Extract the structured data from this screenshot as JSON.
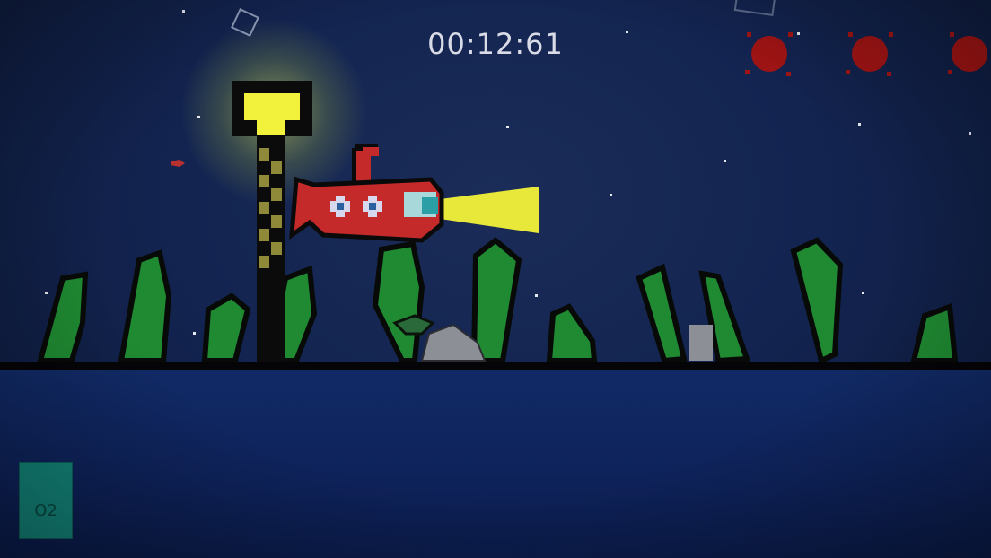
{
  "hud": {
    "timer": "00:12:61",
    "oxygen_label": "O2",
    "lives": [
      "life-1",
      "life-2",
      "life-3"
    ]
  },
  "colors": {
    "night_sky": "#132451",
    "water": "#0e225a",
    "seaweed": "#1f8a32",
    "submarine_body": "#c52a2a",
    "lamp_light": "#f2f23c",
    "oxygen_gauge": "#13857a",
    "life_marker": "#a01414"
  }
}
